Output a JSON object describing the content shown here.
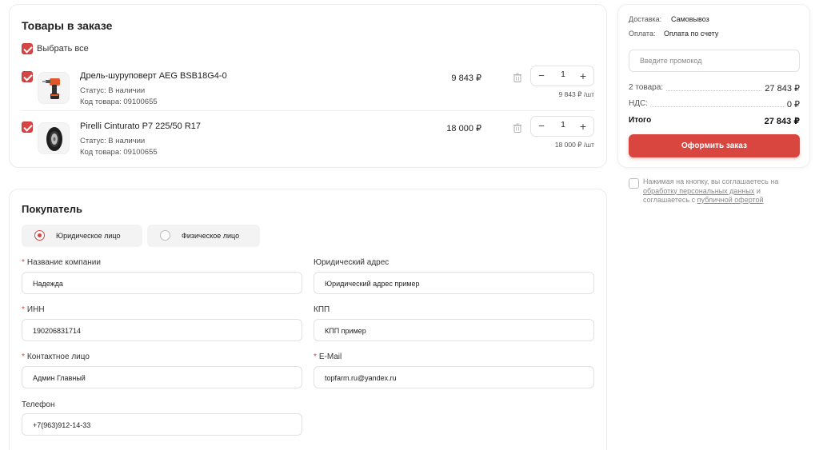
{
  "products_section": {
    "title": "Товары в заказе",
    "select_all_label": "Выбрать все",
    "items": [
      {
        "name": "Дрель-шуруповерт AEG BSB18G4-0",
        "status": "Статус: В наличии",
        "code": "Код товара: 09100655",
        "price": "9 843 ₽",
        "quantity": "1",
        "unit_price": "9 843 ₽ /шт",
        "checked": true,
        "thumb_icon": "drill-icon"
      },
      {
        "name": "Pirelli Cinturato P7 225/50 R17",
        "status": "Статус: В наличии",
        "code": "Код товара: 09100655",
        "price": "18 000 ₽",
        "quantity": "1",
        "unit_price": "18 000 ₽ /шт",
        "checked": true,
        "thumb_icon": "tire-icon"
      }
    ],
    "minus_symbol": "−",
    "plus_symbol": "+"
  },
  "summary": {
    "delivery_label": "Доставка:",
    "delivery_value": "Самовывоз",
    "payment_label": "Оплата:",
    "payment_value": "Оплата по счету",
    "promo_placeholder": "Введите промокод",
    "items_label": "2 товара:",
    "items_value": "27 843 ₽",
    "vat_label": "НДС:",
    "vat_value": "0 ₽",
    "total_label": "Итого",
    "total_value": "27 843 ₽",
    "order_button": "Оформить заказ"
  },
  "consent": {
    "text_1": "Нажимая на кнопку, вы соглашаетесь на ",
    "link_1": "обработку персональных данных",
    "text_2": " и соглашаетесь с ",
    "link_2": "публичной офертой",
    "checked": false
  },
  "buyer": {
    "title": "Покупатель",
    "types": [
      {
        "label": "Юридическое лицо",
        "selected": true
      },
      {
        "label": "Физическое лицо",
        "selected": false
      }
    ],
    "required_mark": "*",
    "fields": {
      "company_name": {
        "label": "Название компании",
        "value": "Надежда",
        "required": true
      },
      "legal_address": {
        "label": "Юридический адрес",
        "value": "Юридический адрес пример",
        "required": false
      },
      "inn": {
        "label": "ИНН",
        "value": "190206831714",
        "required": true
      },
      "kpp": {
        "label": "КПП",
        "value": "КПП пример",
        "required": false
      },
      "contact_person": {
        "label": "Контактное лицо",
        "value": "Админ Главный",
        "required": true
      },
      "email": {
        "label": "E-Mail",
        "value": "topfarm.ru@yandex.ru",
        "required": true
      },
      "phone": {
        "label": "Телефон",
        "value": "+7(963)912-14-33",
        "required": false
      }
    }
  },
  "colors": {
    "accent": "#d64545",
    "button": "#d9463f",
    "border": "#ececec",
    "muted_text": "#8a8a8a"
  }
}
